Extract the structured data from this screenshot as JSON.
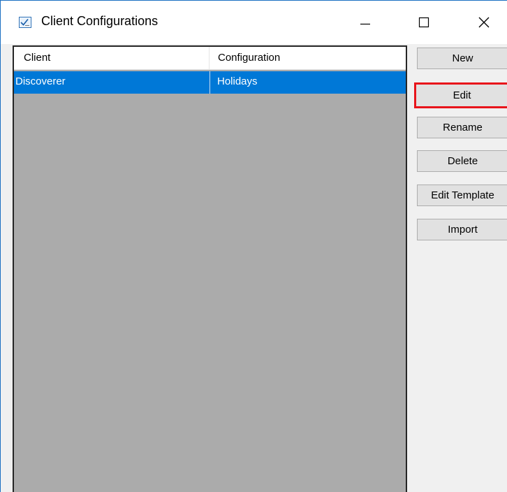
{
  "window": {
    "title": "Client Configurations",
    "icon": "checklist-icon",
    "controls": {
      "minimize_icon": "minimize-icon",
      "maximize_icon": "maximize-icon",
      "close_icon": "close-icon"
    }
  },
  "list": {
    "columns": [
      "Client",
      "Configuration"
    ],
    "rows": [
      {
        "client": "Discoverer",
        "configuration": "Holidays",
        "selected": true
      }
    ],
    "colors": {
      "selection": "#0078d7",
      "empty_area": "#ababab"
    }
  },
  "buttons": {
    "new": "New",
    "edit": "Edit",
    "rename": "Rename",
    "delete": "Delete",
    "edit_template": "Edit Template",
    "import": "Import"
  },
  "highlight": {
    "target": "edit",
    "color": "#e8141b"
  }
}
